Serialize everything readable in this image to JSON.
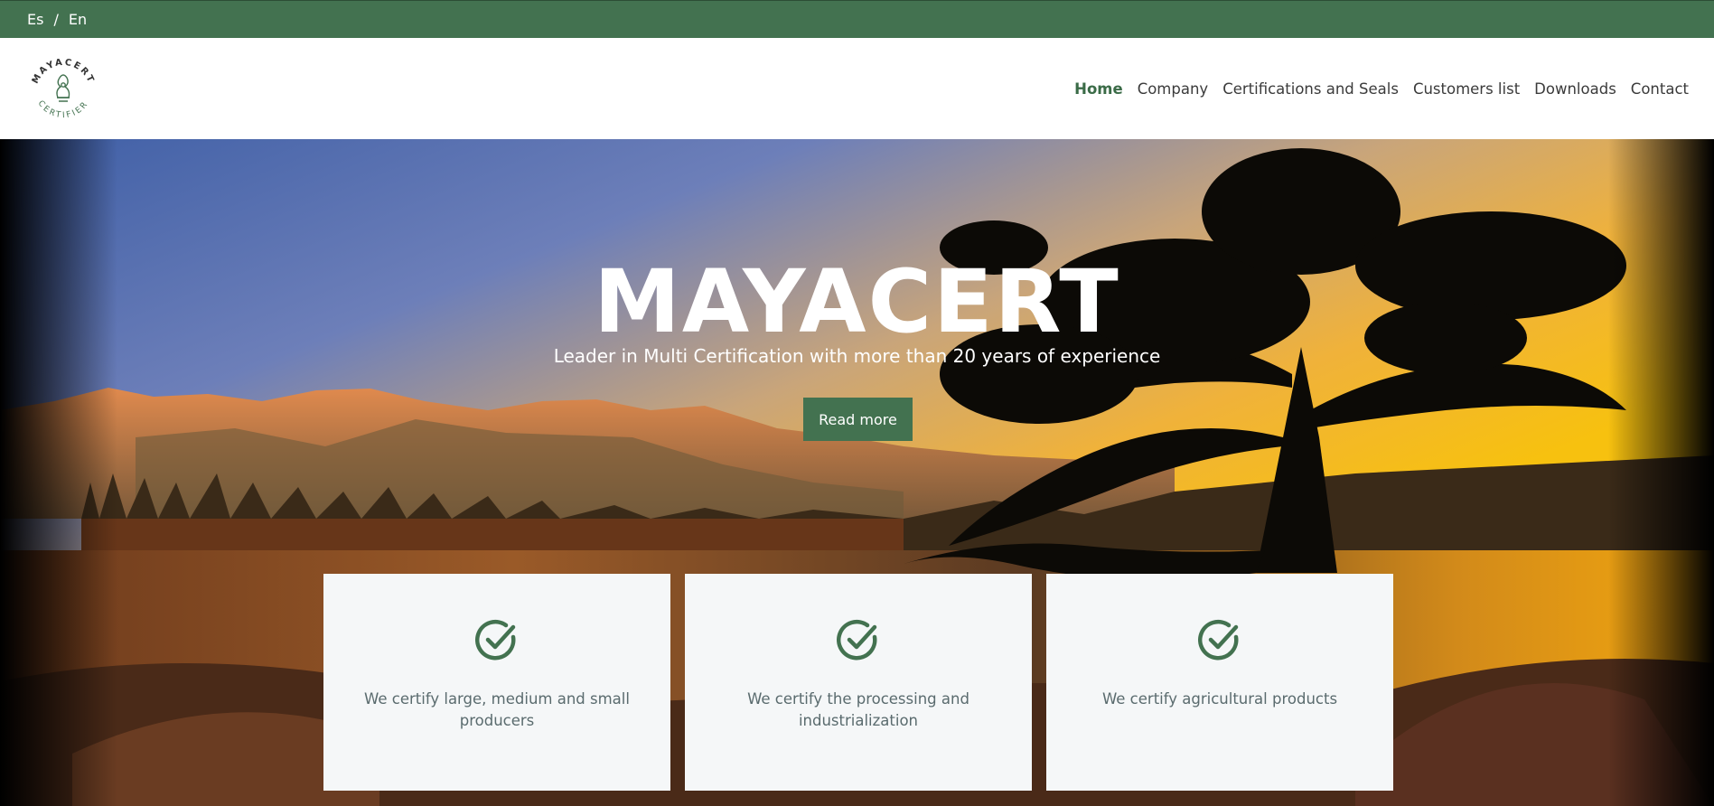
{
  "topbar": {
    "languages": [
      {
        "label": "Es"
      },
      {
        "label": "En"
      }
    ],
    "separator": "/"
  },
  "header": {
    "logo": {
      "top_text": "MAYACERT",
      "bottom_text": "CERTIFIER"
    },
    "nav": [
      {
        "label": "Home",
        "active": true
      },
      {
        "label": "Company"
      },
      {
        "label": "Certifications and Seals"
      },
      {
        "label": "Customers list"
      },
      {
        "label": "Downloads"
      },
      {
        "label": "Contact"
      }
    ]
  },
  "hero": {
    "title": "MAYACERT",
    "subtitle": "Leader in Multi Certification with more than 20 years of experience",
    "button_label": "Read more"
  },
  "cards": [
    {
      "icon": "check-circle-icon",
      "text": "We certify large, medium and small producers"
    },
    {
      "icon": "check-circle-icon",
      "text": "We certify the processing and industrialization"
    },
    {
      "icon": "check-circle-icon",
      "text": "We certify agricultural products"
    }
  ],
  "colors": {
    "brand_green": "#437250",
    "nav_active": "#3a6b47",
    "card_bg": "#f5f7f8"
  }
}
